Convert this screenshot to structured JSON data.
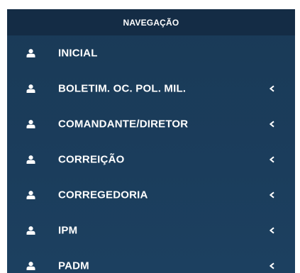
{
  "nav": {
    "header": "NAVEGAÇÃO",
    "items": [
      {
        "label": "INICIAL",
        "icon": "user-icon",
        "has_submenu": false
      },
      {
        "label": "BOLETIM. OC. POL. MIL.",
        "icon": "user-icon",
        "has_submenu": true
      },
      {
        "label": "COMANDANTE/DIRETOR",
        "icon": "user-icon",
        "has_submenu": true
      },
      {
        "label": "CORREIÇÃO",
        "icon": "user-icon",
        "has_submenu": true
      },
      {
        "label": "CORREGEDORIA",
        "icon": "user-icon",
        "has_submenu": true
      },
      {
        "label": "IPM",
        "icon": "user-icon",
        "has_submenu": true
      },
      {
        "label": "PADM",
        "icon": "user-icon",
        "has_submenu": true
      }
    ]
  },
  "colors": {
    "sidebar_bg": "#1b3d5c",
    "header_bg": "#142c45",
    "text": "#ffffff"
  }
}
